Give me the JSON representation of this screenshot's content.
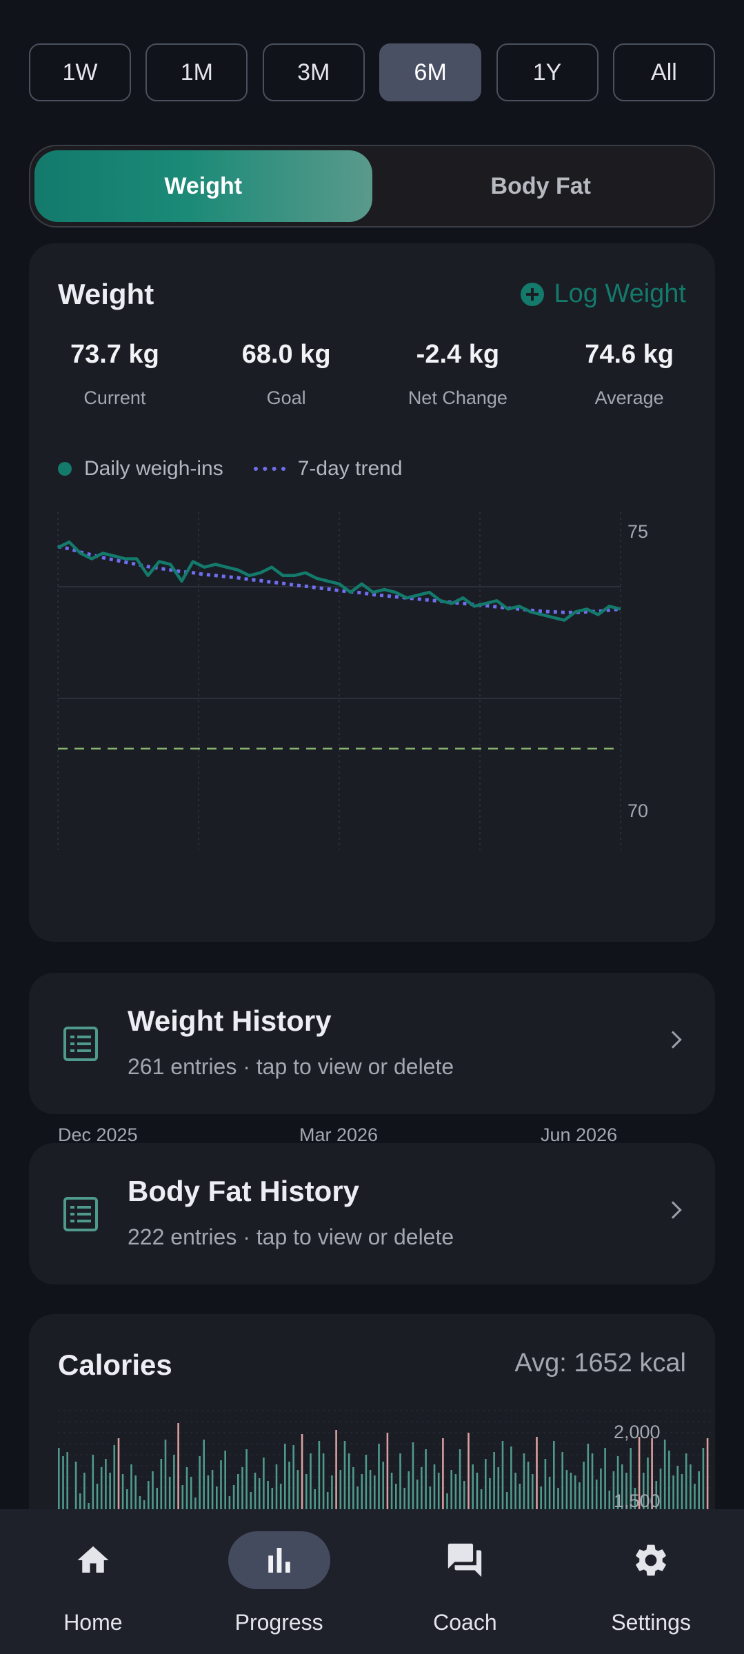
{
  "ranges": [
    {
      "label": "1W",
      "active": false
    },
    {
      "label": "1M",
      "active": false
    },
    {
      "label": "3M",
      "active": false
    },
    {
      "label": "6M",
      "active": true
    },
    {
      "label": "1Y",
      "active": false
    },
    {
      "label": "All",
      "active": false
    }
  ],
  "segment": {
    "weight": "Weight",
    "body_fat": "Body Fat"
  },
  "weight_card": {
    "title": "Weight",
    "log_label": "Log Weight",
    "stats": [
      {
        "value": "73.7 kg",
        "label": "Current"
      },
      {
        "value": "68.0 kg",
        "label": "Goal"
      },
      {
        "value": "-2.4 kg",
        "label": "Net Change"
      },
      {
        "value": "74.6 kg",
        "label": "Average"
      }
    ],
    "legend": {
      "daily": "Daily weigh-ins",
      "trend": "7-day trend"
    }
  },
  "chart_data": {
    "type": "line",
    "x": [
      0,
      2,
      4,
      6,
      8,
      10,
      12,
      14,
      16,
      18,
      20,
      22,
      24,
      26,
      28,
      30,
      32,
      34,
      36,
      38,
      40,
      42,
      44,
      46,
      48,
      50,
      52,
      54,
      56,
      58,
      60,
      62,
      64,
      66,
      68,
      70,
      72,
      74,
      76,
      78,
      80,
      82,
      84,
      86,
      88,
      90,
      92,
      94,
      96,
      98,
      100
    ],
    "x_tick_labels": [
      "Dec 2025",
      "Mar 2026",
      "Jun 2026"
    ],
    "ylim": [
      70,
      75
    ],
    "y_tick_labels": [
      "75",
      "70"
    ],
    "goal_line": 68.0,
    "goal_display_y": 71.1,
    "series": [
      {
        "name": "Daily weigh-ins",
        "color": "#137a6c",
        "values": [
          74.7,
          74.8,
          74.6,
          74.5,
          74.6,
          74.55,
          74.5,
          74.5,
          74.2,
          74.45,
          74.4,
          74.1,
          74.45,
          74.35,
          74.4,
          74.35,
          74.3,
          74.2,
          74.25,
          74.35,
          74.2,
          74.2,
          74.25,
          74.15,
          74.1,
          74.05,
          73.9,
          74.05,
          73.9,
          73.95,
          73.9,
          73.8,
          73.85,
          73.9,
          73.75,
          73.7,
          73.8,
          73.65,
          73.7,
          73.75,
          73.6,
          73.65,
          73.55,
          73.5,
          73.45,
          73.4,
          73.55,
          73.6,
          73.5,
          73.65,
          73.6
        ]
      },
      {
        "name": "7-day trend",
        "color": "#6f6ef0",
        "values": [
          74.72,
          74.68,
          74.62,
          74.57,
          74.52,
          74.48,
          74.44,
          74.4,
          74.36,
          74.33,
          74.3,
          74.27,
          74.25,
          74.22,
          74.2,
          74.18,
          74.16,
          74.13,
          74.11,
          74.08,
          74.06,
          74.03,
          74.01,
          73.98,
          73.96,
          73.93,
          73.91,
          73.89,
          73.86,
          73.84,
          73.82,
          73.8,
          73.78,
          73.76,
          73.74,
          73.72,
          73.7,
          73.68,
          73.66,
          73.64,
          73.62,
          73.6,
          73.58,
          73.56,
          73.55,
          73.54,
          73.54,
          73.55,
          73.56,
          73.58,
          73.6
        ]
      }
    ]
  },
  "histories": [
    {
      "title": "Weight History",
      "subtitle": "261 entries · tap to view or delete"
    },
    {
      "title": "Body Fat History",
      "subtitle": "222 entries · tap to view or delete"
    }
  ],
  "calories": {
    "title": "Calories",
    "avg": "Avg: 1652 kcal",
    "y_tick_labels": [
      "2,000",
      "1,500"
    ],
    "ylim": [
      1400,
      2150
    ],
    "values": [
      1880,
      1820,
      1850,
      1420,
      1780,
      1550,
      1700,
      1480,
      1830,
      1620,
      1740,
      1800,
      1700,
      1900,
      1950,
      1690,
      1580,
      1760,
      1680,
      1530,
      1500,
      1640,
      1710,
      1590,
      1800,
      1940,
      1670,
      1830,
      2060,
      1610,
      1740,
      1670,
      1520,
      1820,
      1940,
      1680,
      1720,
      1600,
      1790,
      1860,
      1530,
      1610,
      1690,
      1740,
      1870,
      1560,
      1700,
      1660,
      1810,
      1640,
      1590,
      1760,
      1620,
      1910,
      1780,
      1900,
      1720,
      1980,
      1690,
      1840,
      1580,
      1930,
      1840,
      1560,
      1680,
      2010,
      1720,
      1930,
      1840,
      1740,
      1600,
      1690,
      1830,
      1720,
      1680,
      1910,
      1780,
      1990,
      1700,
      1620,
      1840,
      1590,
      1710,
      1920,
      1650,
      1740,
      1870,
      1600,
      1760,
      1700,
      1950,
      1550,
      1720,
      1690,
      1870,
      1640,
      1990,
      1760,
      1700,
      1580,
      1800,
      1660,
      1850,
      1740,
      1930,
      1560,
      1890,
      1700,
      1620,
      1840,
      1780,
      1690,
      1960,
      1600,
      1800,
      1670,
      1930,
      1590,
      1850,
      1720,
      1700,
      1680,
      1630,
      1780,
      1910,
      1840,
      1650,
      1730,
      1880,
      1570,
      1710,
      1820,
      1760,
      1700,
      1880,
      1590,
      1960,
      1700,
      1810,
      1950,
      1640,
      1730,
      1940,
      1860,
      1680,
      1750,
      1690,
      1840,
      1760,
      1620,
      1710,
      1880,
      1950
    ],
    "bar_color": "#4f9a8c",
    "over_color": "#d9a0a0"
  },
  "nav": [
    {
      "label": "Home",
      "icon": "home-icon",
      "active": false
    },
    {
      "label": "Progress",
      "icon": "bar-chart-icon",
      "active": true
    },
    {
      "label": "Coach",
      "icon": "chat-icon",
      "active": false
    },
    {
      "label": "Settings",
      "icon": "gear-icon",
      "active": false
    }
  ]
}
